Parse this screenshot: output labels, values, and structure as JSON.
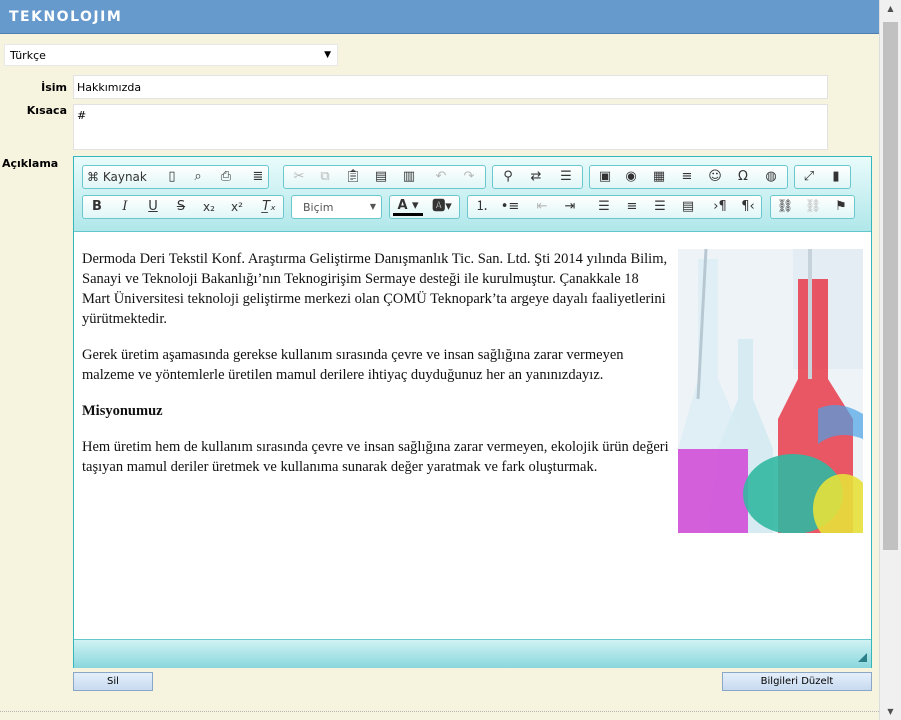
{
  "header": {
    "logo": "TEKNOLOJIM"
  },
  "language": {
    "selected": "Türkçe"
  },
  "form": {
    "name_label": "İsim",
    "name_value": "Hakkımızda",
    "short_label": "Kısaca",
    "short_value": "#",
    "desc_label": "Açıklama"
  },
  "editor": {
    "source_label": "Kaynak",
    "format_label": "Biçim",
    "content": {
      "p1": "Dermoda Deri Tekstil Konf. Araştırma Geliştirme Danışmanlık Tic. San. Ltd. Şti 2014 yılında Bilim, Sanayi ve Teknoloji Bakanlığı’nın Teknogirişim Sermaye desteği ile kurulmuştur. Çanakkale 18 Mart Üniversitesi teknoloji geliştirme merkezi olan ÇOMÜ Teknopark’ta argeye dayalı faaliyetlerini yürütmektedir.",
      "p2": "Gerek üretim aşamasında gerekse kullanım sırasında çevre ve insan sağlığına zarar vermeyen malzeme ve yöntemlerle üretilen mamul derilere ihtiyaç duyduğunuz her an yanınızdayız.",
      "h": "Misyonumuz",
      "p3": "Hem üretim hem de kullanım sırasında çevre ve insan sağlığına zarar vermeyen, ekolojik ürün değeri taşıyan mamul deriler üretmek ve kullanıma sunarak değer yaratmak ve fark oluşturmak."
    }
  },
  "buttons": {
    "delete": "Sil",
    "update": "Bilgileri Düzelt"
  }
}
